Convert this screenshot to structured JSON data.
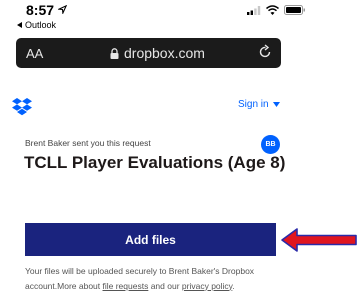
{
  "status_bar": {
    "time": "8:57",
    "back_app": "Outlook"
  },
  "browser": {
    "text_size_label": "AA",
    "url": "dropbox.com"
  },
  "header": {
    "sign_in_label": "Sign in"
  },
  "request": {
    "sender_text": "Brent Baker sent you this request",
    "avatar_initials": "BB",
    "title": "TCLL Player Evaluations (Age 8)",
    "add_files_label": "Add files",
    "info_text_1": "Your files will be uploaded securely to Brent Baker's Dropbox account.More about ",
    "file_requests_link": "file requests",
    "info_text_2": " and our ",
    "privacy_link": "privacy policy",
    "info_text_3": "."
  },
  "colors": {
    "brand_blue": "#0061fe",
    "button_navy": "#1a237e",
    "annotation_arrow": "#e0151f"
  }
}
